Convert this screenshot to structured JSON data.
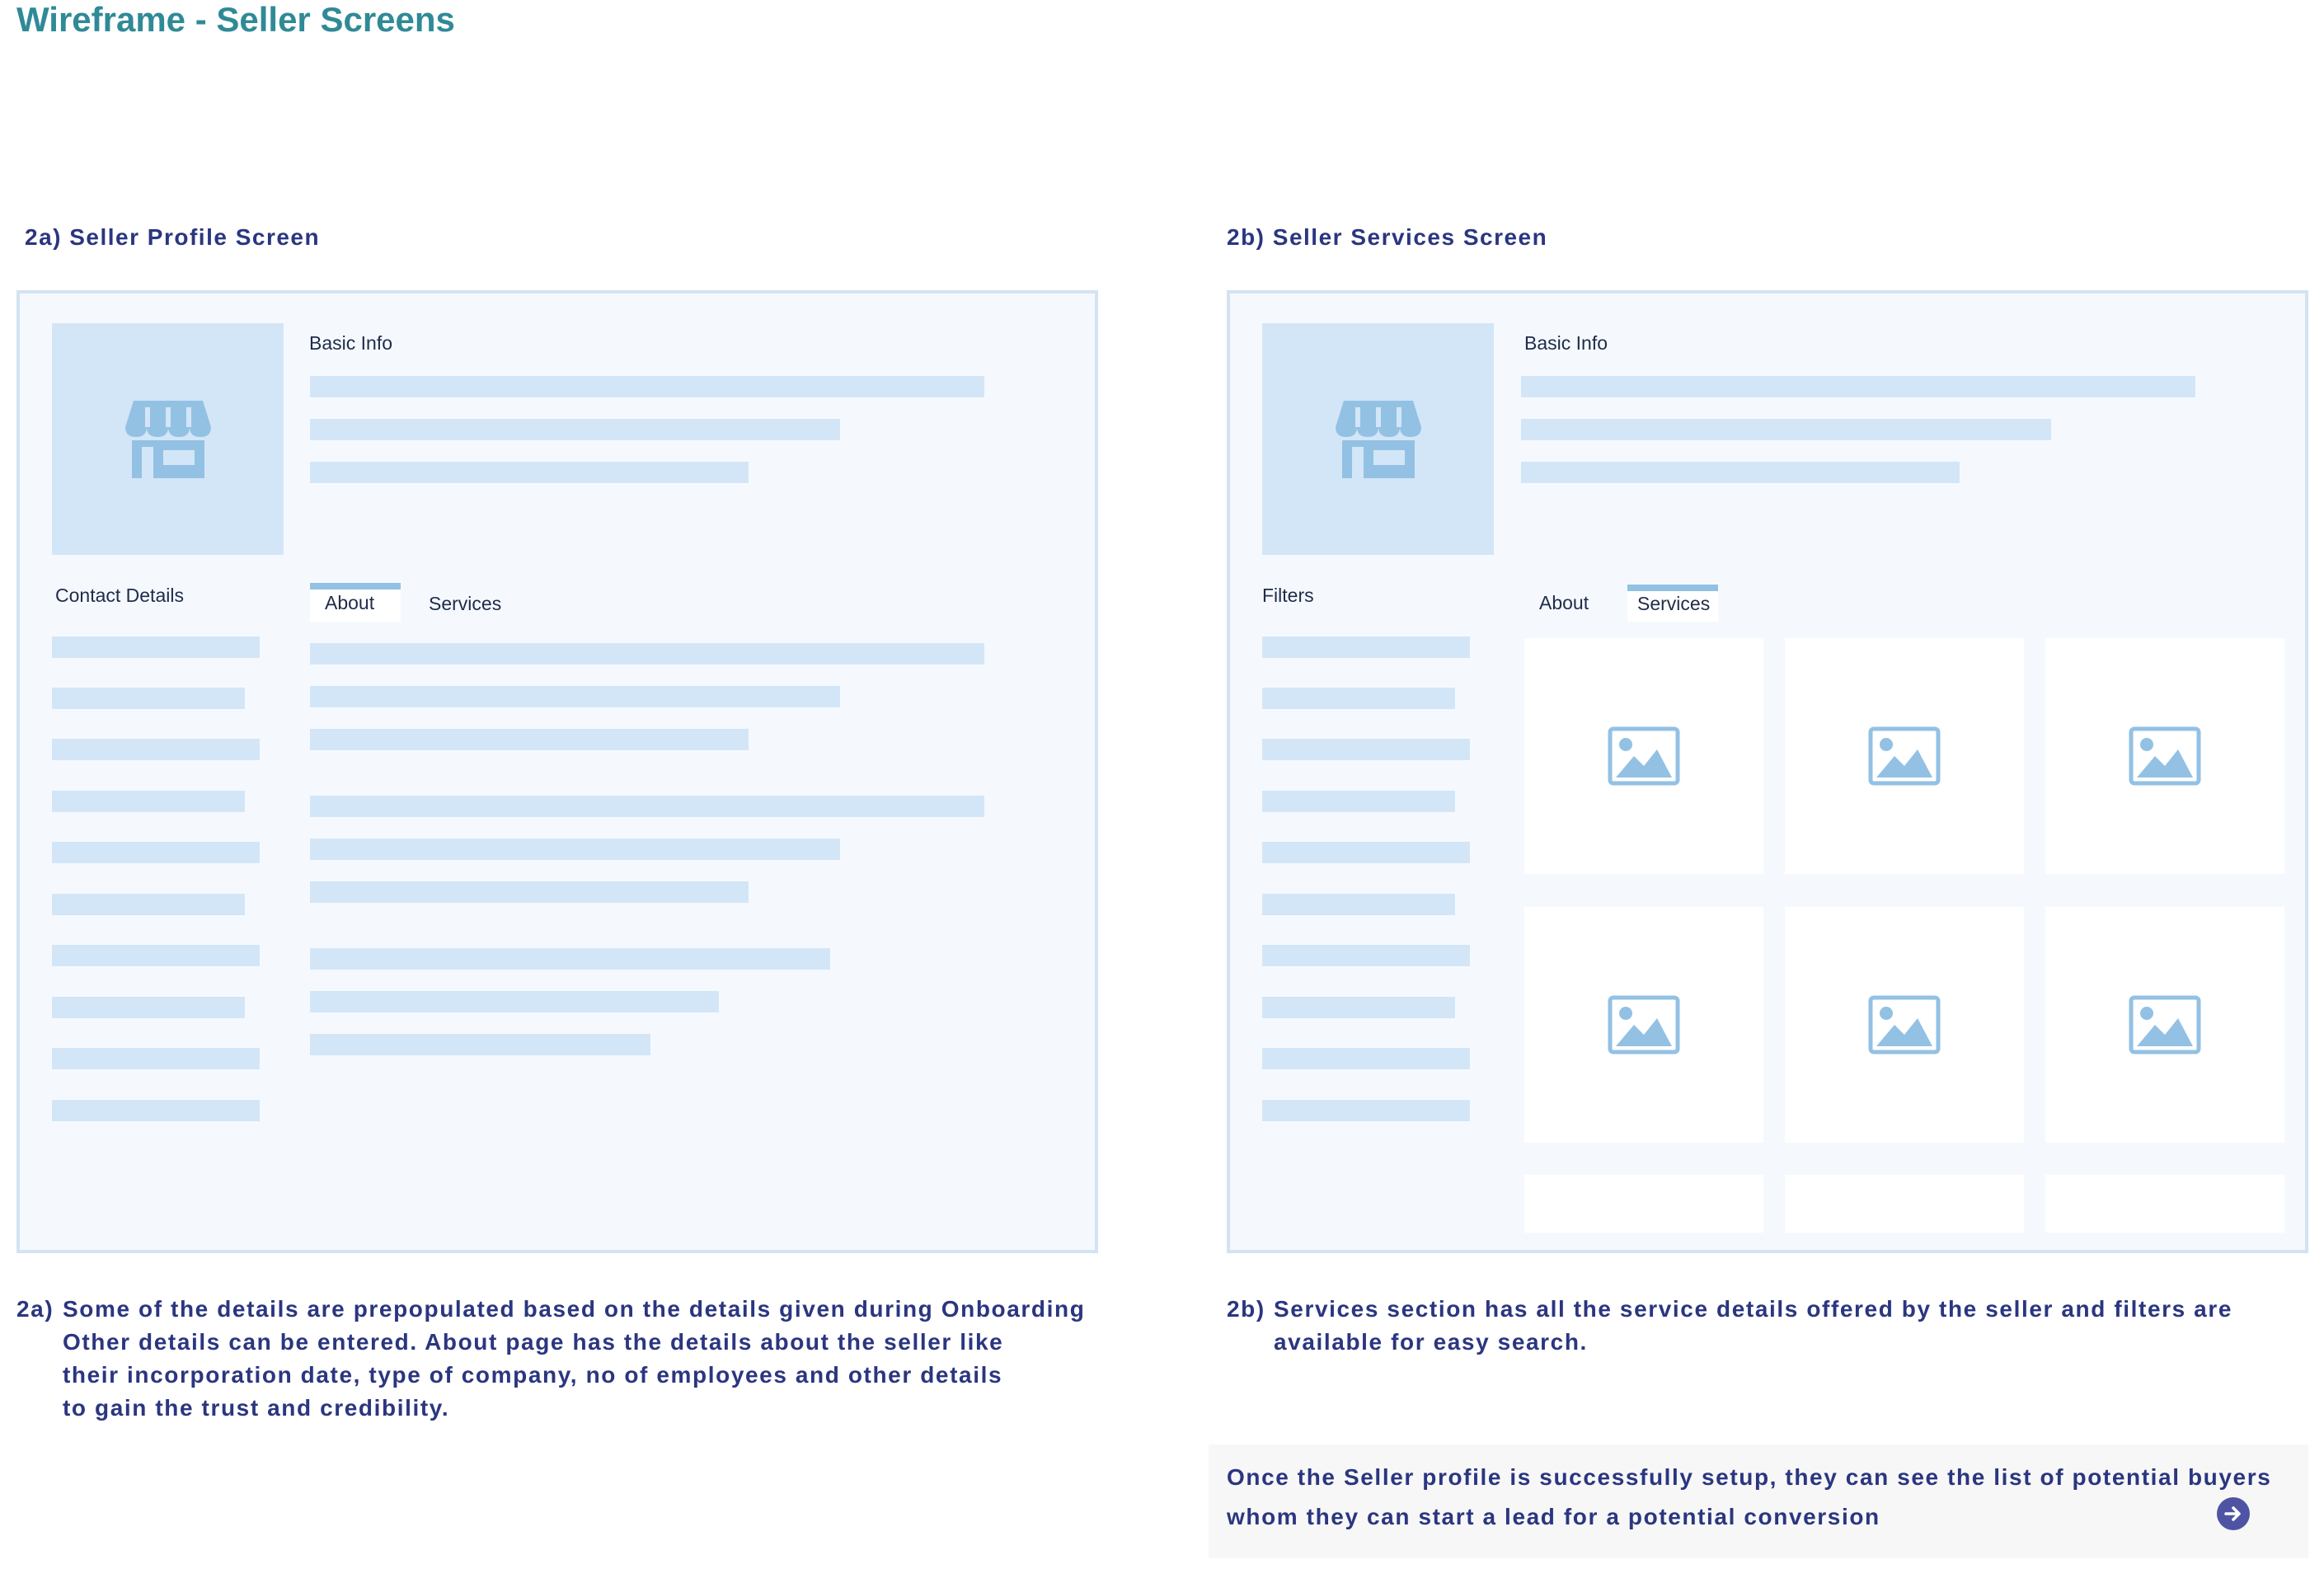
{
  "page": {
    "title": "Wireframe - Seller Screens"
  },
  "left": {
    "heading": "2a) Seller Profile Screen",
    "basic_info_label": "Basic Info",
    "contact_label": "Contact Details",
    "tabs": [
      {
        "label": "About",
        "active": true
      },
      {
        "label": "Services",
        "active": false
      }
    ],
    "icons": {
      "store": "store-icon"
    },
    "description": {
      "prefix": "2a)",
      "lines": [
        "Some of the details are prepopulated based on the details given during Onboarding",
        "Other details can be entered. About page has the details about the seller like",
        "their incorporation date, type of company, no of employees and other details",
        "to gain the trust and credibility."
      ]
    }
  },
  "right": {
    "heading": "2b) Seller Services Screen",
    "basic_info_label": "Basic Info",
    "filters_label": "Filters",
    "tabs": [
      {
        "label": "About",
        "active": false
      },
      {
        "label": "Services",
        "active": true
      }
    ],
    "icons": {
      "store": "store-icon",
      "service_card": "image-placeholder-icon"
    },
    "description": {
      "prefix": "2b)",
      "lines": [
        "Services section has all the service details offered by the seller and filters are",
        "available for easy search."
      ]
    }
  },
  "note": {
    "lines": [
      "Once the Seller profile is successfully setup, they can see the list of potential buyers",
      "whom they can start a lead for a potential conversion"
    ],
    "icon": "arrow-right-circle-icon"
  },
  "colors": {
    "title": "#2f8a96",
    "heading_text": "#2b3680",
    "frame_bg": "#f5f9fe",
    "frame_border": "#d3e3f1",
    "placeholder": "#d3e6f7",
    "icon": "#93c1e4",
    "accent_button": "#4e54a3"
  }
}
